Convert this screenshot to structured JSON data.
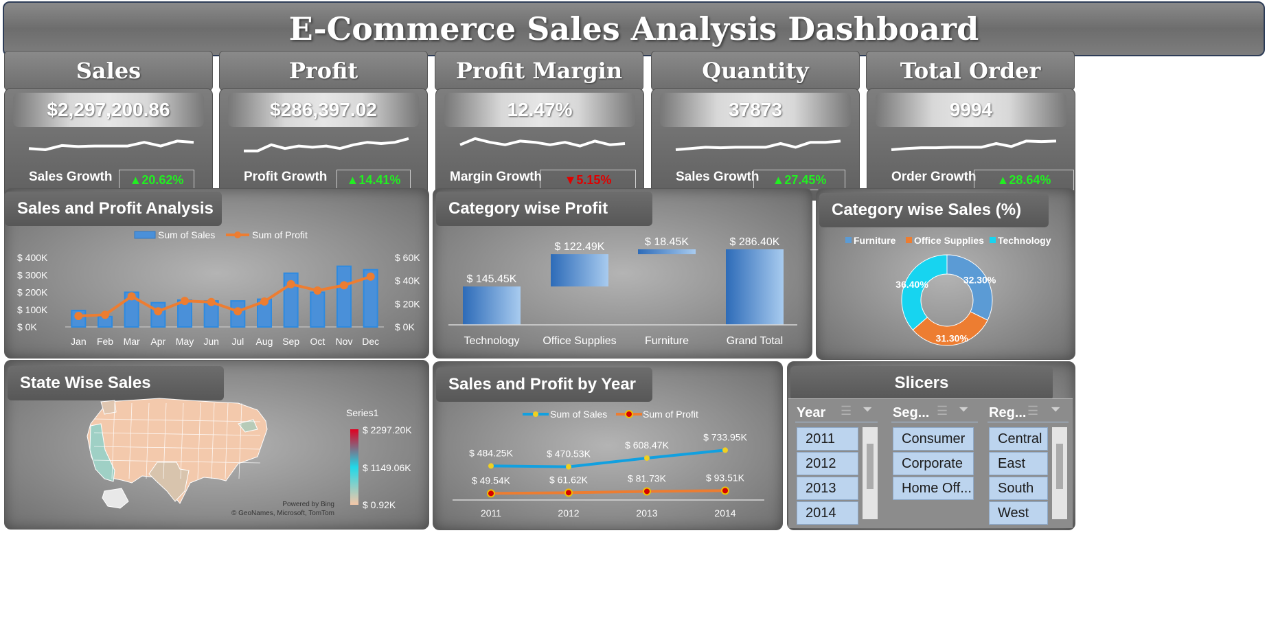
{
  "title": "E-Commerce Sales Analysis Dashboard",
  "kpis": [
    {
      "name": "Sales",
      "value": "$2,297,200.86",
      "growth_label": "Sales Growth",
      "growth": "20.62%",
      "direction": "up",
      "spark": [
        0.3,
        0.25,
        0.42,
        0.38,
        0.4,
        0.4,
        0.4,
        0.55,
        0.4,
        0.6,
        0.55
      ]
    },
    {
      "name": "Profit",
      "value": "$286,397.02",
      "growth_label": "Profit Growth",
      "growth": "14.41%",
      "direction": "up",
      "spark": [
        0.2,
        0.2,
        0.45,
        0.3,
        0.4,
        0.35,
        0.4,
        0.3,
        0.45,
        0.55,
        0.5,
        0.55,
        0.7
      ]
    },
    {
      "name": "Profit Margin",
      "value": "12.47%",
      "growth_label": "Margin Growth",
      "growth": "5.15%",
      "direction": "down",
      "spark": [
        0.45,
        0.7,
        0.55,
        0.45,
        0.6,
        0.55,
        0.45,
        0.55,
        0.4,
        0.6,
        0.45,
        0.5
      ]
    },
    {
      "name": "Quantity",
      "value": "37873",
      "growth_label": "Sales Growth",
      "growth": "27.45%",
      "direction": "up",
      "spark": [
        0.25,
        0.3,
        0.35,
        0.33,
        0.35,
        0.35,
        0.35,
        0.5,
        0.35,
        0.55,
        0.55,
        0.6
      ]
    },
    {
      "name": "Total Order",
      "value": "9994",
      "growth_label": "Order Growth",
      "growth": "28.64%",
      "direction": "up",
      "spark": [
        0.25,
        0.3,
        0.33,
        0.33,
        0.35,
        0.35,
        0.35,
        0.5,
        0.38,
        0.6,
        0.58,
        0.6
      ]
    }
  ],
  "sections": {
    "sales_profit": "Sales and Profit Analysis",
    "category_profit": "Category wise Profit",
    "category_sales": "Category wise Sales (%)",
    "state_sales": "State Wise Sales",
    "year_chart": "Sales and Profit by Year",
    "slicers": "Slicers"
  },
  "chart_data": [
    {
      "type": "bar+line",
      "title": "Sales and Profit Analysis",
      "categories": [
        "Jan",
        "Feb",
        "Mar",
        "Apr",
        "May",
        "Jun",
        "Jul",
        "Aug",
        "Sep",
        "Oct",
        "Nov",
        "Dec"
      ],
      "series": [
        {
          "name": "Sum of Sales",
          "type": "bar",
          "axis": "left",
          "values": [
            95000,
            60000,
            200000,
            140000,
            155000,
            150000,
            150000,
            160000,
            310000,
            200000,
            350000,
            330000
          ]
        },
        {
          "name": "Sum of Profit",
          "type": "line",
          "axis": "right",
          "values": [
            9500,
            10500,
            26500,
            13500,
            22500,
            21500,
            13500,
            22000,
            37000,
            31500,
            36000,
            43500
          ]
        }
      ],
      "y_left": {
        "ticks": [
          "$ 0K",
          "$ 100K",
          "$ 200K",
          "$ 300K",
          "$ 400K"
        ],
        "range": [
          0,
          400000
        ]
      },
      "y_right": {
        "ticks": [
          "$ 0K",
          "$ 20K",
          "$ 40K",
          "$ 60K"
        ],
        "range": [
          0,
          60000
        ]
      },
      "legend": "top-center"
    },
    {
      "type": "waterfall",
      "title": "Category wise Profit",
      "categories": [
        "Technology",
        "Office Supplies",
        "Furniture",
        "Grand Total"
      ],
      "values": [
        145.45,
        122.49,
        18.45,
        286.4
      ],
      "labels": [
        "$ 145.45K",
        "$ 122.49K",
        "$ 18.45K",
        "$ 286.40K"
      ]
    },
    {
      "type": "pie",
      "title": "Category wise Sales (%)",
      "categories": [
        "Furniture",
        "Office Supplies",
        "Technology"
      ],
      "values": [
        32.3,
        31.3,
        36.4
      ],
      "labels": [
        "32.30%",
        "31.30%",
        "36.40%"
      ],
      "colors": [
        "#5b9bd5",
        "#ed7d31",
        "#17d4f0"
      ],
      "legend": "top"
    },
    {
      "type": "line",
      "title": "Sales and Profit by Year",
      "x": [
        "2011",
        "2012",
        "2013",
        "2014"
      ],
      "series": [
        {
          "name": "Sum of Sales",
          "values": [
            484.25,
            470.53,
            608.47,
            733.95
          ],
          "labels": [
            "$ 484.25K",
            "$ 470.53K",
            "$ 608.47K",
            "$ 733.95K"
          ],
          "color": "#11a0e0"
        },
        {
          "name": "Sum of Profit",
          "values": [
            49.54,
            61.62,
            81.73,
            93.51
          ],
          "labels": [
            "$ 49.54K",
            "$ 61.62K",
            "$ 81.73K",
            "$ 93.51K"
          ],
          "color": "#ed7d31"
        }
      ],
      "legend": "top-center"
    }
  ],
  "map": {
    "series_label": "Series1",
    "scale_max": "$ 2297.20K",
    "scale_mid": "$ 1149.06K",
    "scale_min": "$ 0.92K",
    "credit_1": "Powered by Bing",
    "credit_2": "© GeoNames, Microsoft, TomTom"
  },
  "slicers": {
    "year": {
      "title": "Year",
      "items": [
        "2011",
        "2012",
        "2013",
        "2014"
      ]
    },
    "segment": {
      "title": "Seg...",
      "items": [
        "Consumer",
        "Corporate",
        "Home Off..."
      ]
    },
    "region": {
      "title": "Reg...",
      "items": [
        "Central",
        "East",
        "South",
        "West"
      ]
    }
  }
}
